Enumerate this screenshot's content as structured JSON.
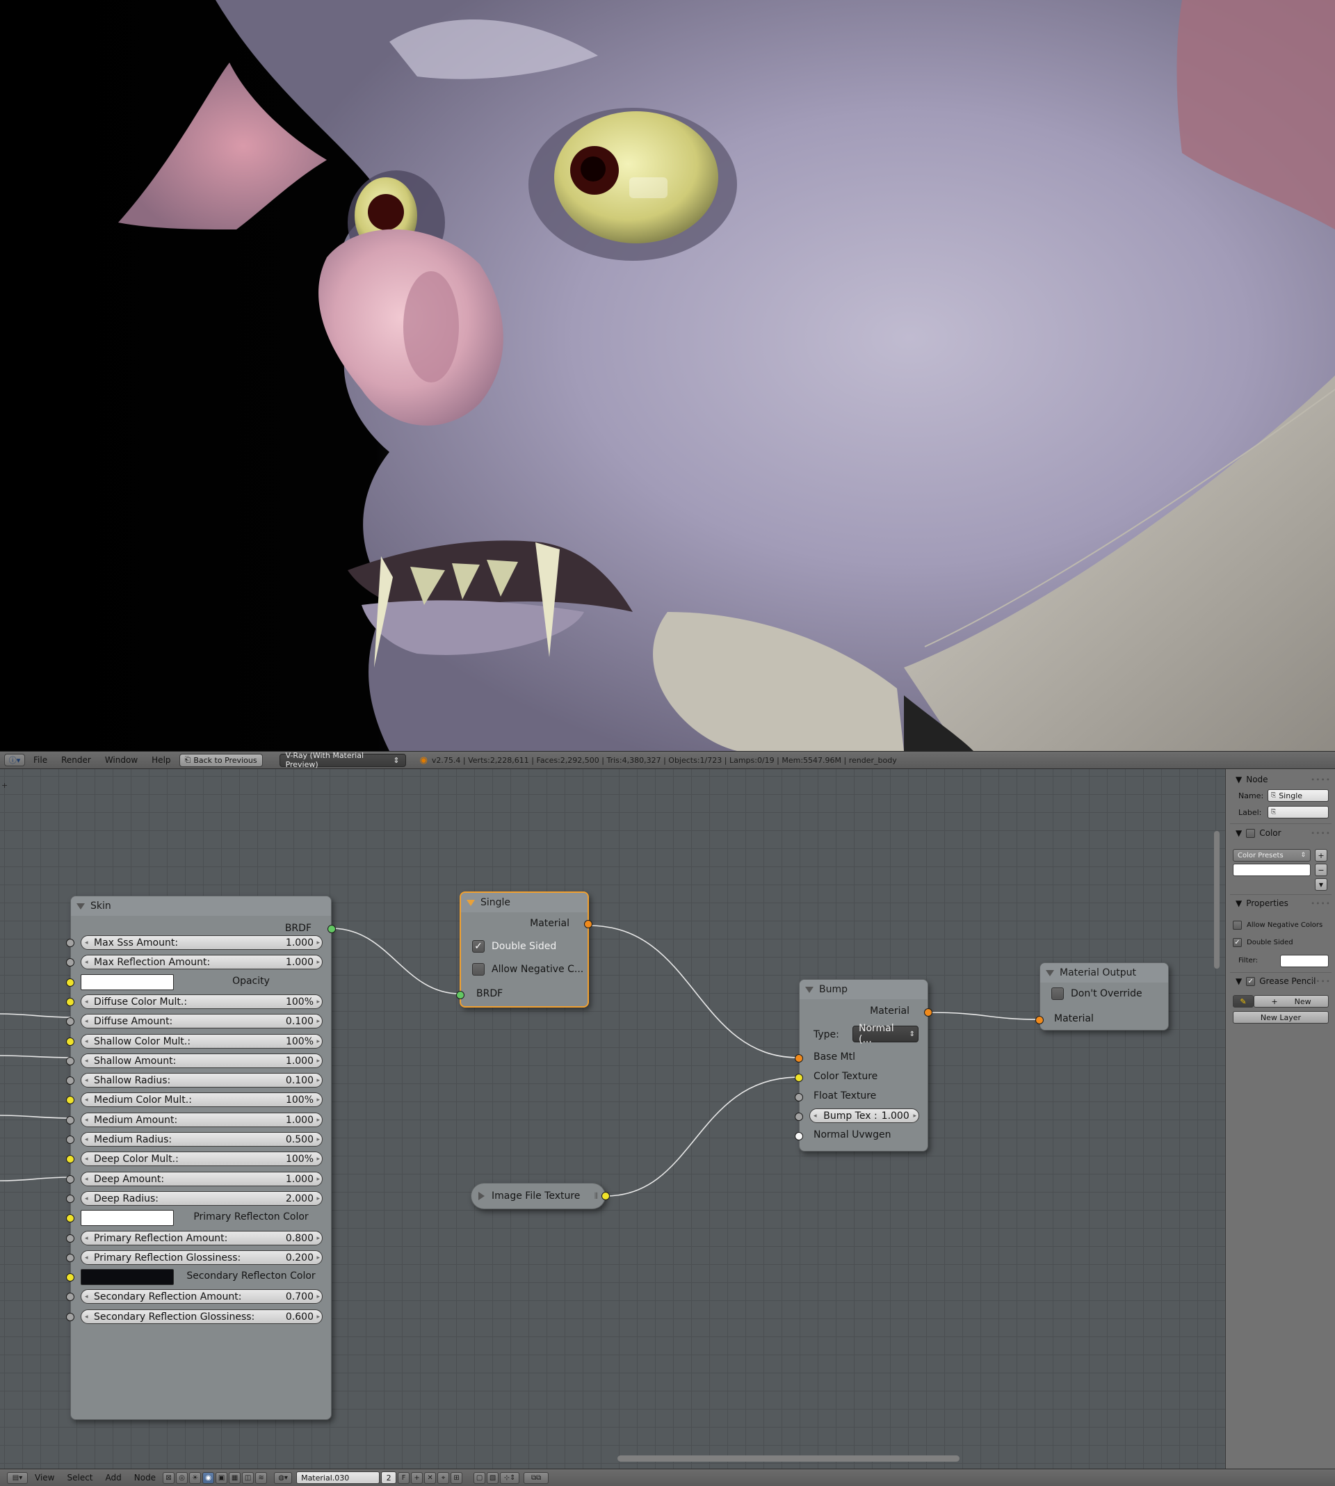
{
  "header": {
    "menus": [
      "File",
      "Render",
      "Window",
      "Help"
    ],
    "back_button": "Back to Previous",
    "render_engine": "V-Ray (With Material Preview)",
    "stats": "v2.75.4 | Verts:2,228,611 | Faces:2,292,500 | Tris:4,380,327 | Objects:1/723 | Lamps:0/19 | Mem:5547.96M | render_body"
  },
  "nodes": {
    "skin": {
      "title": "Skin",
      "output": "BRDF",
      "rows": [
        {
          "label": "Max Sss Amount:",
          "value": "1.000",
          "kind": "field",
          "socket": "grey"
        },
        {
          "label": "Max Reflection Amount:",
          "value": "1.000",
          "kind": "field",
          "socket": "grey"
        },
        {
          "label": "Opacity",
          "value": "",
          "kind": "swatch",
          "socket": "yellow",
          "swatch": "#ffffff"
        },
        {
          "label": "Diffuse Color Mult.:",
          "value": "100%",
          "kind": "field",
          "socket": "yellow"
        },
        {
          "label": "Diffuse Amount:",
          "value": "0.100",
          "kind": "field",
          "socket": "grey"
        },
        {
          "label": "Shallow Color Mult.:",
          "value": "100%",
          "kind": "field",
          "socket": "yellow"
        },
        {
          "label": "Shallow Amount:",
          "value": "1.000",
          "kind": "field",
          "socket": "grey"
        },
        {
          "label": "Shallow Radius:",
          "value": "0.100",
          "kind": "field",
          "socket": "grey"
        },
        {
          "label": "Medium Color Mult.:",
          "value": "100%",
          "kind": "field",
          "socket": "yellow"
        },
        {
          "label": "Medium Amount:",
          "value": "1.000",
          "kind": "field",
          "socket": "grey"
        },
        {
          "label": "Medium Radius:",
          "value": "0.500",
          "kind": "field",
          "socket": "grey"
        },
        {
          "label": "Deep Color Mult.:",
          "value": "100%",
          "kind": "field",
          "socket": "yellow"
        },
        {
          "label": "Deep Amount:",
          "value": "1.000",
          "kind": "field",
          "socket": "grey"
        },
        {
          "label": "Deep Radius:",
          "value": "2.000",
          "kind": "field",
          "socket": "grey"
        },
        {
          "label": "Primary Reflecton Color",
          "value": "",
          "kind": "swatch",
          "socket": "yellow",
          "swatch": "#ffffff"
        },
        {
          "label": "Primary Reflection Amount:",
          "value": "0.800",
          "kind": "field",
          "socket": "grey"
        },
        {
          "label": "Primary Reflection Glossiness:",
          "value": "0.200",
          "kind": "field",
          "socket": "grey"
        },
        {
          "label": "Secondary Reflecton Color",
          "value": "",
          "kind": "swatch",
          "socket": "yellow",
          "swatch": "#0b0c10"
        },
        {
          "label": "Secondary Reflection Amount:",
          "value": "0.700",
          "kind": "field",
          "socket": "grey"
        },
        {
          "label": "Secondary Reflection Glossiness:",
          "value": "0.600",
          "kind": "field",
          "socket": "grey"
        }
      ]
    },
    "single": {
      "title": "Single",
      "output": "Material",
      "double_sided": "Double Sided",
      "double_sided_checked": true,
      "allow_negative": "Allow Negative C...",
      "allow_negative_checked": false,
      "input": "BRDF"
    },
    "bump": {
      "title": "Bump",
      "output": "Material",
      "type_label": "Type:",
      "type_value": "Normal (...",
      "inputs": [
        "Base Mtl",
        "Color Texture",
        "Float Texture"
      ],
      "bump_tex_label": "Bump Tex :",
      "bump_tex_value": "1.000",
      "normal_uvwgen": "Normal Uvwgen"
    },
    "material_output": {
      "title": "Material Output",
      "dont_override": "Don't Override",
      "dont_override_checked": false,
      "input": "Material"
    },
    "image_texture": {
      "title": "Image File Texture"
    }
  },
  "panel": {
    "node_section": "Node",
    "name_label": "Name:",
    "name_value": "Single",
    "label_label": "Label:",
    "label_value": "",
    "color_section": "Color",
    "color_presets": "Color Presets",
    "properties_section": "Properties",
    "allow_negative_colors": "Allow Negative Colors",
    "allow_negative_colors_checked": false,
    "double_sided": "Double Sided",
    "double_sided_checked": true,
    "filter_label": "Filter:",
    "filter_value": "",
    "grease_pencil_section": "Grease Pencil",
    "new_button": "New",
    "new_layer_button": "New Layer"
  },
  "footer": {
    "menus": [
      "View",
      "Select",
      "Add",
      "Node"
    ],
    "material_name": "Material.030",
    "user_count": "2",
    "fake_user": "F"
  },
  "colors": {
    "socket_brdf": "#63c763",
    "socket_color": "#f0e32a",
    "socket_material": "#f08a1c",
    "socket_float": "#a3a3a3",
    "selection_outline": "#f0a030",
    "node_body": "#858a8c",
    "editor_background": "#555a5d"
  }
}
